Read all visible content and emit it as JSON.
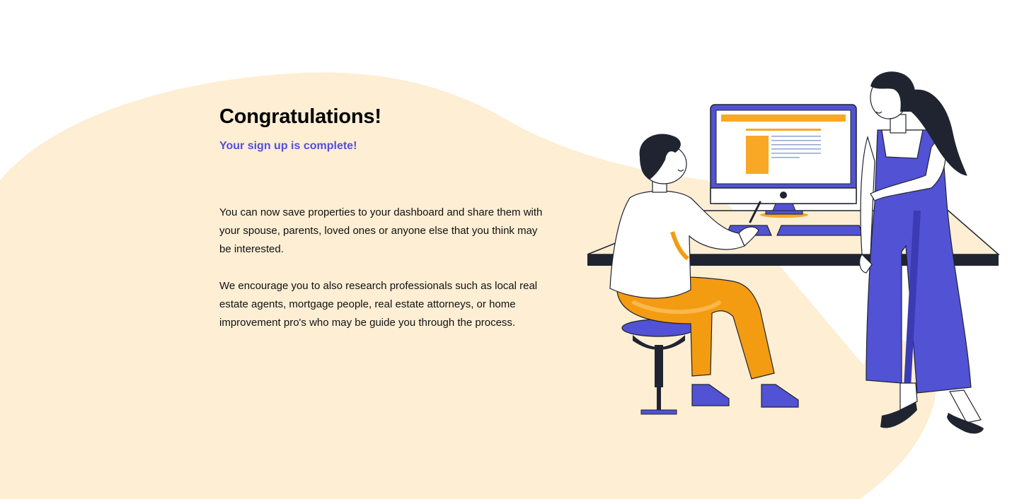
{
  "heading": {
    "title": "Congratulations!",
    "subtitle": "Your sign up is complete!"
  },
  "body": {
    "paragraph_1": "You can now save properties to your dashboard and share them with your spouse, parents, loved ones or anyone else that you think may be interested.",
    "paragraph_2": "We encourage you to also research professionals such as local real estate agents, mortgage people, real estate attorneys, or home improvement pro's who may be guide you through the process."
  },
  "colors": {
    "background_blob": "#fdeed4",
    "accent_purple": "#5252d4",
    "accent_orange": "#f9a825",
    "ink": "#1f2430"
  },
  "illustration": {
    "icon": "people-at-computer-illustration"
  }
}
